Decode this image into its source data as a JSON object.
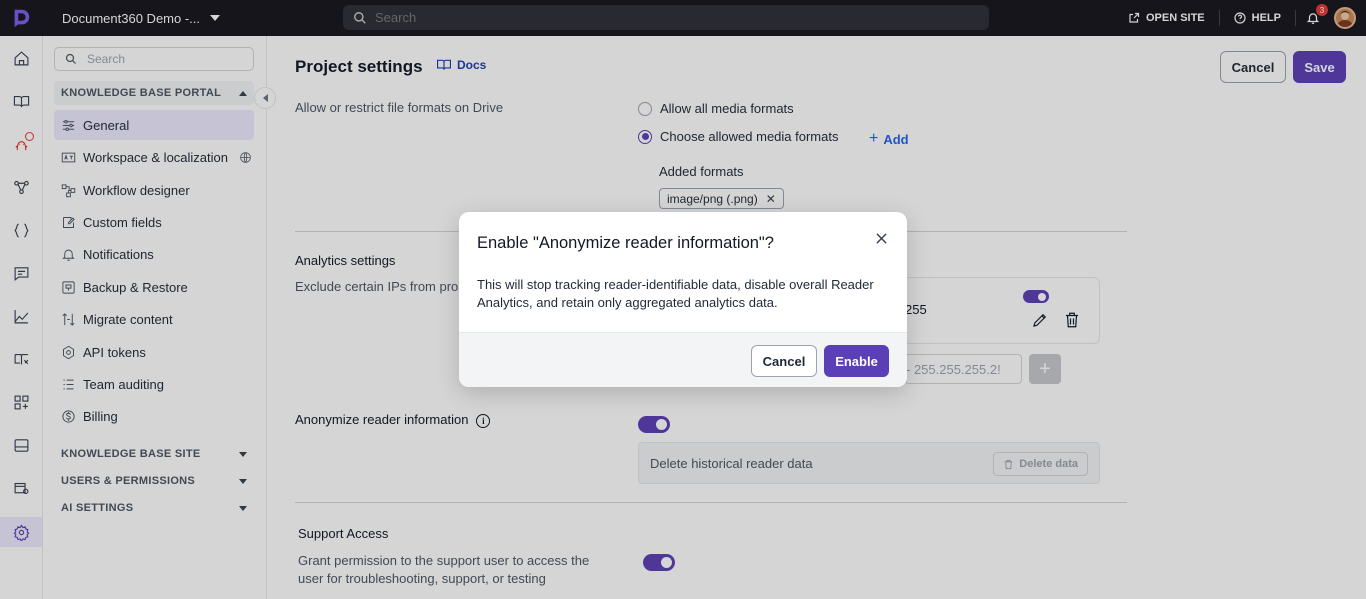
{
  "topbar": {
    "project_name": "Document360 Demo -...",
    "search_placeholder": "Search",
    "open_site": "OPEN SITE",
    "help": "HELP",
    "notification_count": "3"
  },
  "sidebar": {
    "search_placeholder": "Search",
    "sections": {
      "knowledge_base_portal": "KNOWLEDGE BASE PORTAL",
      "knowledge_base_site": "KNOWLEDGE BASE SITE",
      "users_permissions": "USERS & PERMISSIONS",
      "ai_settings": "AI SETTINGS"
    },
    "items": [
      {
        "label": "General",
        "icon": "sliders-icon"
      },
      {
        "label": "Workspace & localization",
        "icon": "translate-icon"
      },
      {
        "label": "Workflow designer",
        "icon": "workflow-icon"
      },
      {
        "label": "Custom fields",
        "icon": "custom-fields-icon"
      },
      {
        "label": "Notifications",
        "icon": "bell-icon"
      },
      {
        "label": "Backup & Restore",
        "icon": "backup-icon"
      },
      {
        "label": "Migrate content",
        "icon": "migrate-icon"
      },
      {
        "label": "API tokens",
        "icon": "api-icon"
      },
      {
        "label": "Team auditing",
        "icon": "audit-icon"
      },
      {
        "label": "Billing",
        "icon": "billing-icon"
      }
    ]
  },
  "main": {
    "title": "Project settings",
    "docs_label": "Docs",
    "cancel_label": "Cancel",
    "save_label": "Save",
    "drive": {
      "label": "Allow or restrict file formats on Drive",
      "option_all": "Allow all media formats",
      "option_choose": "Choose allowed media formats",
      "add_label": "Add",
      "added_formats_label": "Added formats",
      "formats": [
        "image/png (.png)"
      ]
    },
    "analytics": {
      "title": "Analytics settings",
      "exclude_label": "Exclude certain IPs from pro",
      "ip_range_suffix": "255",
      "ip_input_placeholder": "- 255.255.255.2!"
    },
    "anonymize": {
      "label": "Anonymize reader information",
      "delete_label": "Delete historical reader data",
      "delete_button": "Delete data"
    },
    "support": {
      "title": "Support Access",
      "description": "Grant permission to the support user to access the user for troubleshooting, support, or testing"
    }
  },
  "modal": {
    "title": "Enable \"Anonymize reader information\"?",
    "body": "This will stop tracking reader-identifiable data, disable overall Reader Analytics, and retain only aggregated analytics data.",
    "cancel_label": "Cancel",
    "enable_label": "Enable"
  },
  "colors": {
    "accent": "#5b3fb6",
    "topbar": "#15151d",
    "link": "#2563eb"
  }
}
